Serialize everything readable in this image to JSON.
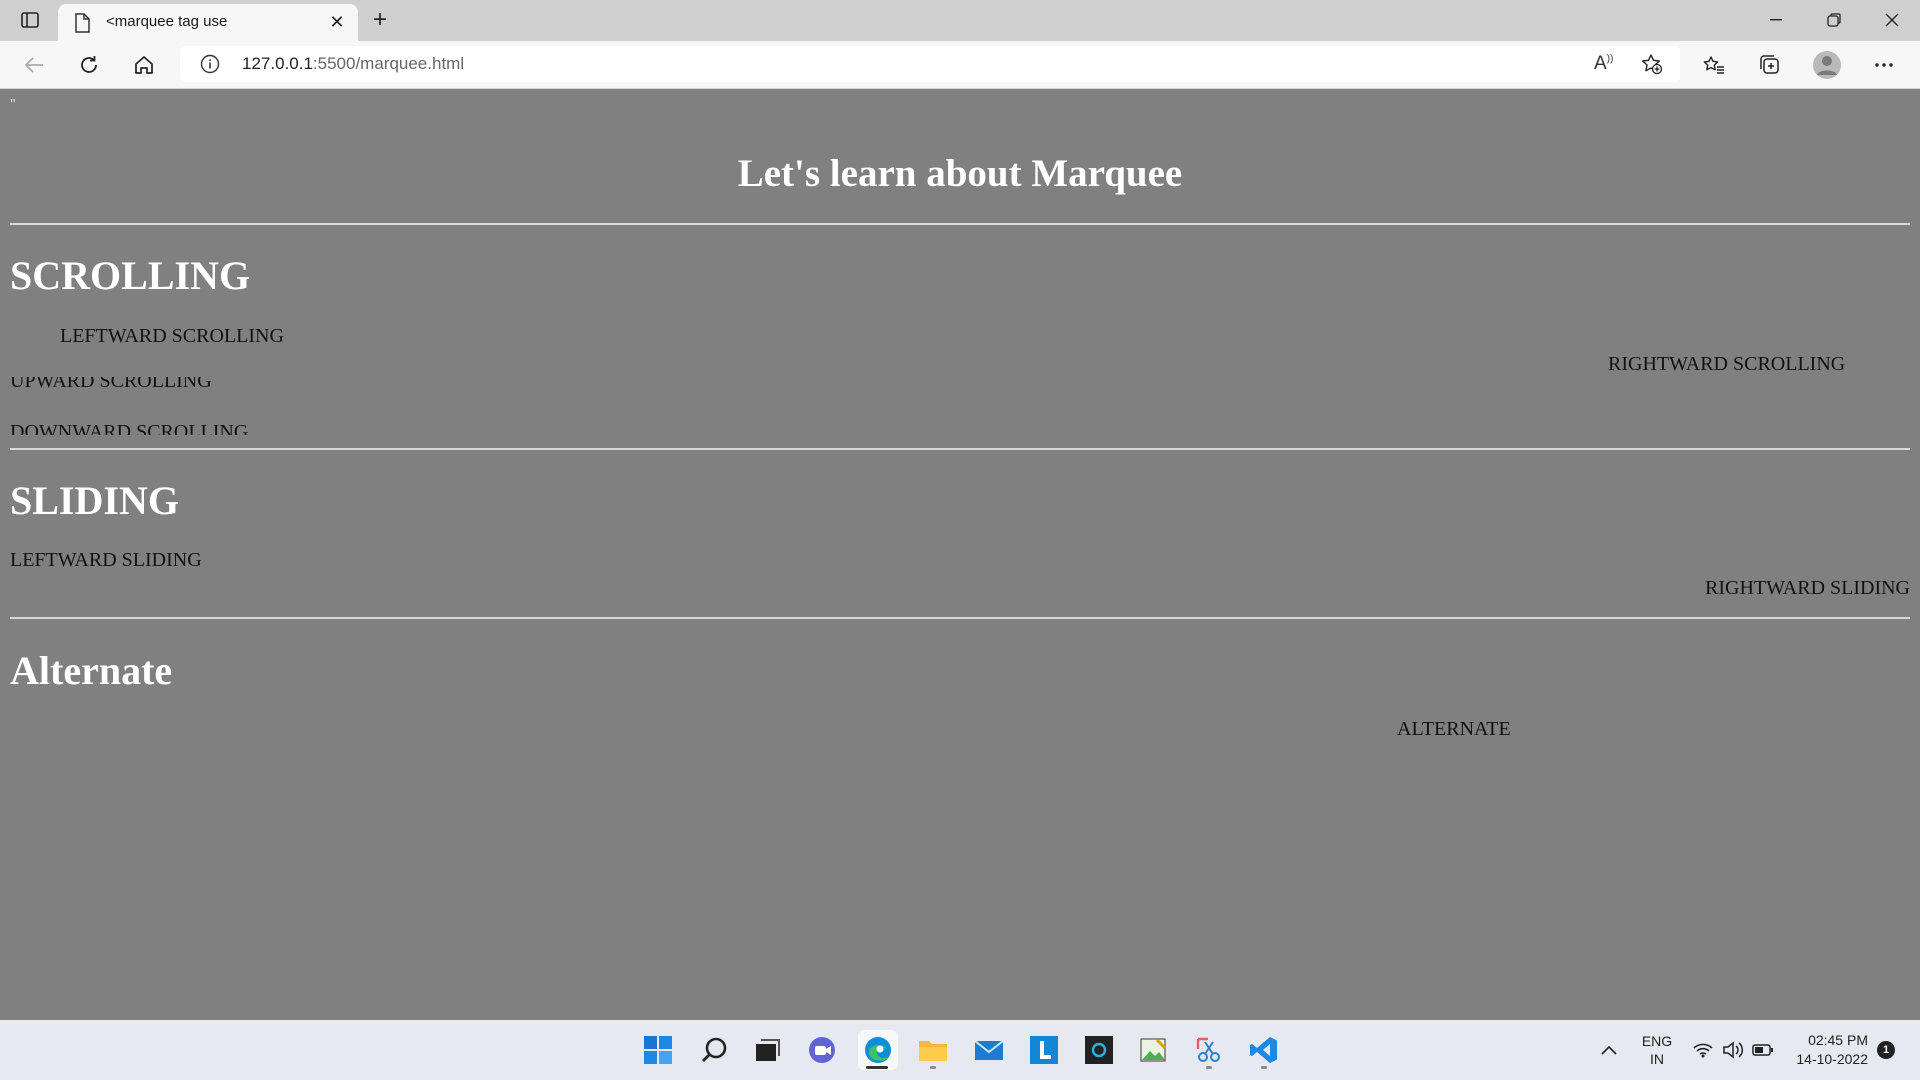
{
  "browser": {
    "tab_title": "<marquee tag use",
    "url_host": "127.0.0.1",
    "url_path": ":5500/marquee.html",
    "read_aloud_label": "A"
  },
  "page": {
    "stray_text": "\"",
    "title": "Let's learn about Marquee",
    "sections": {
      "scrolling": {
        "heading": "SCROLLING",
        "leftward": "LEFTWARD SCROLLING",
        "rightward": "RIGHTWARD SCROLLING",
        "upward": "UPWARD SCROLLING",
        "downward": "DOWNWARD SCROLLING"
      },
      "sliding": {
        "heading": "SLIDING",
        "leftward": "LEFTWARD SLIDING",
        "rightward": "RIGHTWARD SLIDING"
      },
      "alternate": {
        "heading": "Alternate",
        "text": "ALTERNATE"
      }
    }
  },
  "taskbar": {
    "apps": [
      "start-icon",
      "search-icon",
      "task-view-icon",
      "chat-icon",
      "edge-icon",
      "file-explorer-icon",
      "mail-icon",
      "l-app-icon",
      "cortana-icon",
      "photos-icon",
      "snipping-tool-icon",
      "vscode-icon"
    ],
    "lang_top": "ENG",
    "lang_bottom": "IN",
    "time": "02:45 PM",
    "date": "14-10-2022",
    "notification_count": "1"
  },
  "colors": {
    "page_bg": "#808080",
    "heading": "#ffffff",
    "rule": "#d8d8d8"
  }
}
